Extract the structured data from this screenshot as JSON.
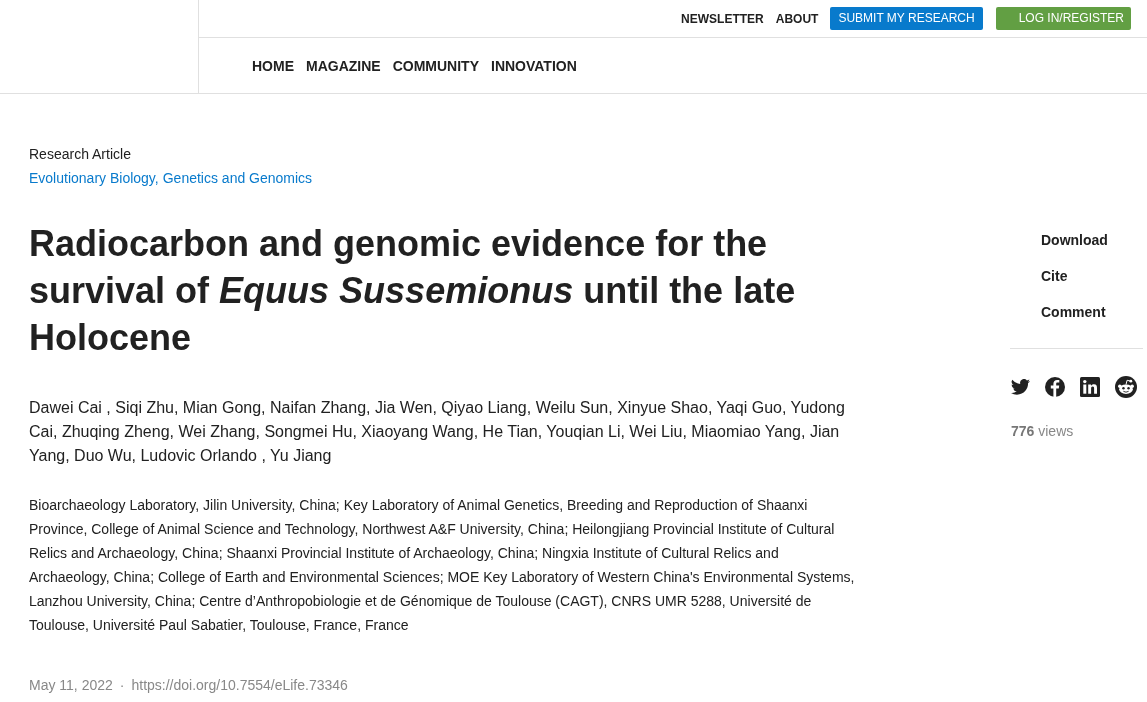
{
  "header": {
    "utility_links": [
      "NEWSLETTER",
      "ABOUT"
    ],
    "buttons": [
      {
        "label": "SUBMIT MY RESEARCH",
        "kind": "primary"
      },
      {
        "label": "LOG IN/REGISTER",
        "kind": "login"
      }
    ],
    "nav": [
      "HOME",
      "MAGAZINE",
      "COMMUNITY",
      "INNOVATION"
    ]
  },
  "article": {
    "type": "Research Article",
    "subjects": [
      "Evolutionary Biology,",
      "Genetics and Genomics"
    ],
    "title": "Radiocarbon and genomic evidence for the survival of *Equus Sussemionus* until the late Holocene",
    "authors": "Dawei Cai , Siqi Zhu, Mian Gong, Naifan Zhang, Jia Wen, Qiyao Liang, Weilu Sun, Xinyue Shao, Yaqi Guo, Yudong Cai, Zhuqing Zheng, Wei Zhang, Songmei Hu, Xiaoyang Wang, He Tian, Youqian Li, Wei Liu, Miaomiao Yang, Jian Yang, Duo Wu, Ludovic Orlando , Yu Jiang",
    "affiliations": "Bioarchaeology Laboratory, Jilin University, China; Key Laboratory of Animal Genetics, Breeding and Reproduction of Shaanxi Province, College of Animal Science and Technology, Northwest A&F University, China; Heilongjiang Provincial Institute of Cultural Relics and Archaeology, China; Shaanxi Provincial Institute of Archaeology, China; Ningxia Institute of Cultural Relics and Archaeology, China; College of Earth and Environmental Sciences; MOE Key Laboratory of Western China's Environmental Systems, Lanzhou University, China; Centre d’Anthropobiologie et de Génomique de Toulouse (CAGT), CNRS UMR 5288, Université de Toulouse, Université Paul Sabatier, Toulouse, France, France",
    "date": "May 11, 2022",
    "separator": "·",
    "doi": "https://doi.org/10.7554/eLife.73346"
  },
  "sidebar": {
    "actions": [
      "Download",
      "Cite",
      "Comment"
    ],
    "views": "**776** views"
  }
}
